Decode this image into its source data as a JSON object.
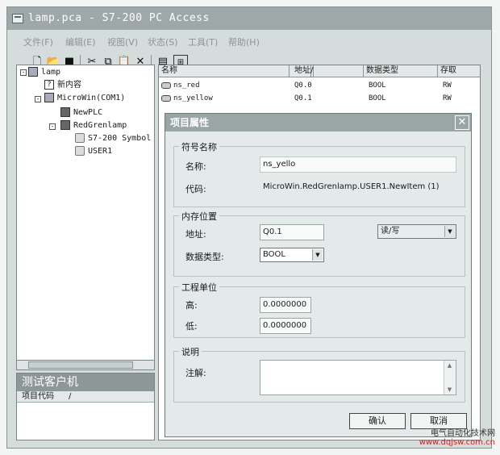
{
  "window": {
    "title": "lamp.pca - S7-200 PC Access"
  },
  "menu": [
    "文件(F)",
    "编辑(E)",
    "视图(V)",
    "状态(S)",
    "工具(T)",
    "帮助(H)"
  ],
  "toolbar": {
    "icons": [
      "new-file-icon",
      "open-folder-icon",
      "save-icon",
      "cut-icon",
      "copy-icon",
      "paste-icon",
      "delete-icon",
      "properties-icon",
      "test-client-icon"
    ]
  },
  "tree": {
    "root": "lamp",
    "new_item": "新内容",
    "microwin": "MicroWin(COM1)",
    "newplc": "NewPLC",
    "redgrenlamp": "RedGrenlamp",
    "symbol": "S7-200 Symbol",
    "user1": "USER1"
  },
  "test_client": {
    "title": "测试客户机",
    "column": "项目代码",
    "sort_mark": "/"
  },
  "list": {
    "headers": {
      "name": "名称",
      "address": "地址",
      "sort_mark": "/",
      "type": "数据类型",
      "access": "存取"
    },
    "rows": [
      {
        "name": "ns_red",
        "address": "Q0.0",
        "type": "BOOL",
        "access": "RW"
      },
      {
        "name": "ns_yellow",
        "address": "Q0.1",
        "type": "BOOL",
        "access": "RW"
      }
    ]
  },
  "dialog": {
    "title": "项目属性",
    "close": "✕",
    "symbol_group": "符号名称",
    "name_label": "名称:",
    "name_value": "ns_yello",
    "code_label": "代码:",
    "code_value": "MicroWin.RedGrenlamp.USER1.NewItem (1)",
    "memory_group": "内存位置",
    "address_label": "地址:",
    "address_value": "Q0.1",
    "access_value": "读/写",
    "datatype_label": "数据类型:",
    "datatype_value": "BOOL",
    "eng_group": "工程单位",
    "high_label": "高:",
    "high_value": "0.0000000",
    "low_label": "低:",
    "low_value": "0.0000000",
    "desc_group": "说明",
    "comment_label": "注解:",
    "ok": "确认",
    "cancel": "取消"
  },
  "watermark": {
    "line1": "电气自动化技术网",
    "line2": "www.dqjsw.com.cn"
  }
}
